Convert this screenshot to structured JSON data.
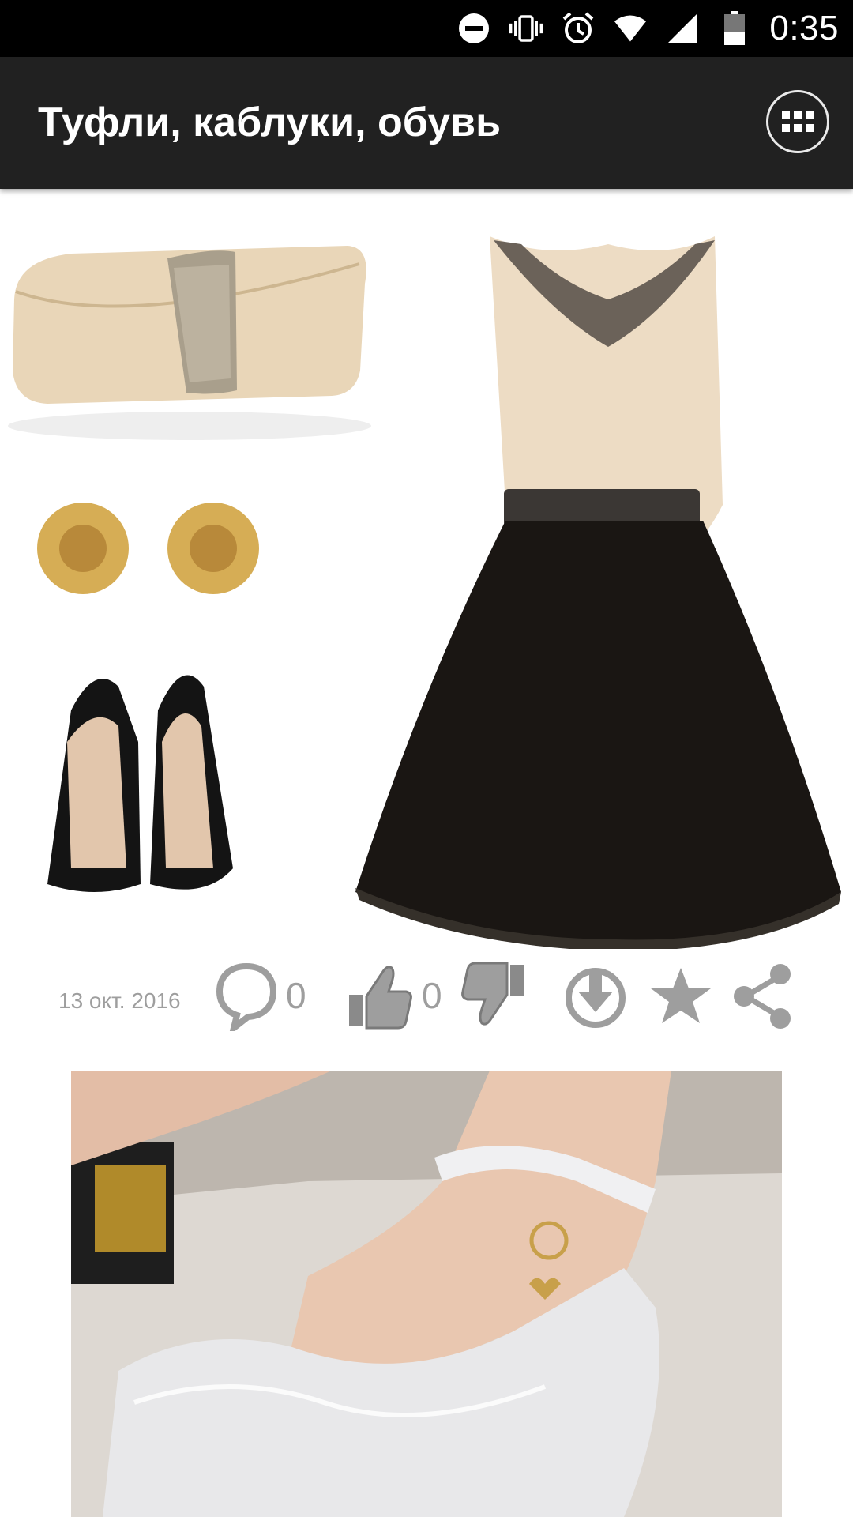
{
  "status_bar": {
    "time": "0:35",
    "icons": [
      "do-not-disturb-icon",
      "vibrate-icon",
      "alarm-icon",
      "wifi-icon",
      "signal-icon",
      "battery-icon"
    ]
  },
  "app_bar": {
    "title": "Туфли, каблуки, обувь",
    "menu_icon": "grid-menu-icon"
  },
  "post": {
    "date": "13 окт. 2016",
    "comments_count": "0",
    "likes_count": "0",
    "actions": [
      "comment-icon",
      "like-icon",
      "dislike-icon",
      "download-icon",
      "star-icon",
      "share-icon"
    ]
  },
  "colors": {
    "status_bar": "#000000",
    "app_bar": "#212121",
    "action_gray": "#9e9e9e"
  }
}
